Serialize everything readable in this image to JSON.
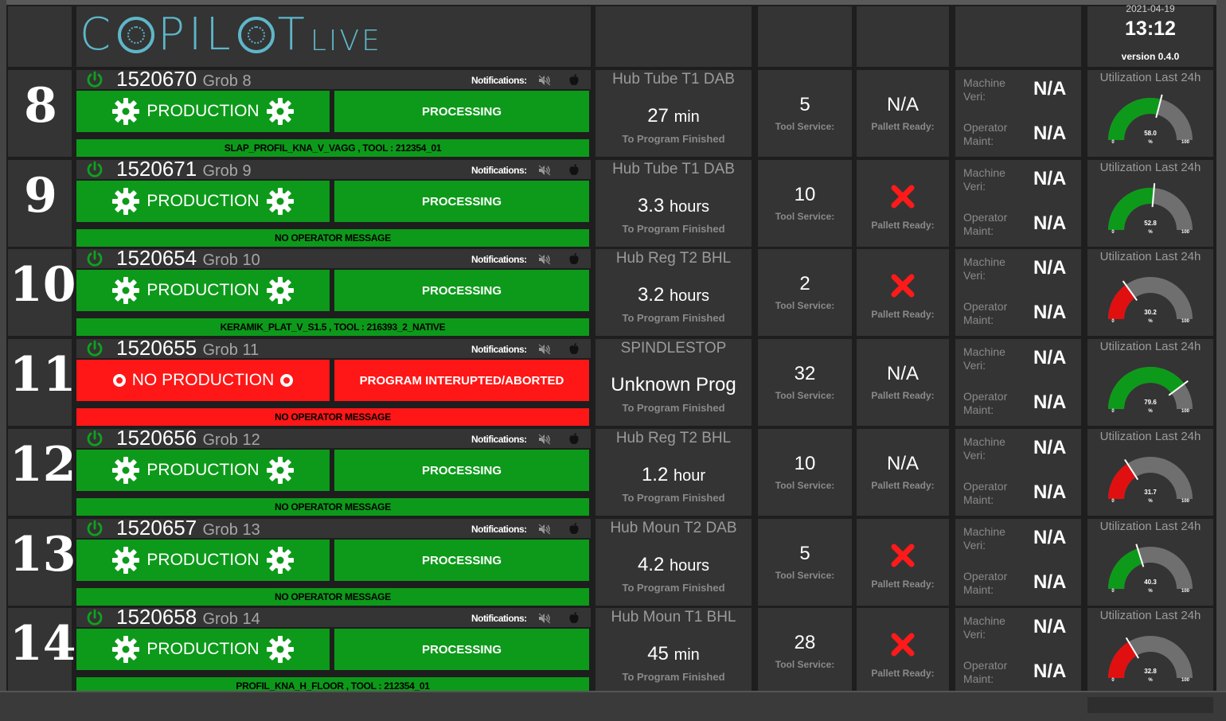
{
  "header": {
    "logo_text": "COPILOT",
    "logo_suffix": "LIVE",
    "date": "2021-04-19",
    "time": "13:12",
    "version": "version 0.4.0"
  },
  "labels": {
    "notifications": "Notifications:",
    "to_program_finished": "To Program Finished",
    "tool_service": "Tool Service:",
    "pallet_ready": "Pallett Ready:",
    "machine_veri": "Machine Veri:",
    "operator_maint": "Operator Maint:",
    "utilization": "Utilization Last 24h",
    "gauge_unit": "%",
    "gauge_min": "0",
    "gauge_max": "100"
  },
  "colors": {
    "production_green": "#0d9a1a",
    "alarm_red": "#ff1616",
    "logo_teal": "#5fb6c9"
  },
  "rows": [
    {
      "number": "8",
      "job_id": "1520670",
      "grob": "Grob 8",
      "state": "PRODUCTION",
      "state_color": "green",
      "status": "PROCESSING",
      "message": "SLAP_PROFIL_KNA_V_VAGG , TOOL : 212354_01",
      "program": "Hub Tube T1 DAB",
      "remaining_value": "27",
      "remaining_unit": "min",
      "tool_service": "5",
      "pallet_ready": "N/A",
      "machine_veri": "N/A",
      "operator_maint": "N/A",
      "utilization": 58.0,
      "utilization_label": "58.0"
    },
    {
      "number": "9",
      "job_id": "1520671",
      "grob": "Grob 9",
      "state": "PRODUCTION",
      "state_color": "green",
      "status": "PROCESSING",
      "message": "NO OPERATOR MESSAGE",
      "program": "Hub Tube T1 DAB",
      "remaining_value": "3.3",
      "remaining_unit": "hours",
      "tool_service": "10",
      "pallet_ready": "x",
      "machine_veri": "N/A",
      "operator_maint": "N/A",
      "utilization": 52.8,
      "utilization_label": "52.8"
    },
    {
      "number": "10",
      "job_id": "1520654",
      "grob": "Grob 10",
      "state": "PRODUCTION",
      "state_color": "green",
      "status": "PROCESSING",
      "message": "KERAMIK_PLAT_V_S1.5 , TOOL : 216393_2_NATIVE",
      "program": "Hub Reg T2 BHL",
      "remaining_value": "3.2",
      "remaining_unit": "hours",
      "tool_service": "2",
      "pallet_ready": "x",
      "machine_veri": "N/A",
      "operator_maint": "N/A",
      "utilization": 30.2,
      "utilization_label": "30.2"
    },
    {
      "number": "11",
      "job_id": "1520655",
      "grob": "Grob 11",
      "state": "NO PRODUCTION",
      "state_color": "red",
      "status": "PROGRAM INTERUPTED/ABORTED",
      "message": "NO OPERATOR MESSAGE",
      "program": "SPINDLESTOP",
      "remaining_value": "Unknown Prog",
      "remaining_unit": "",
      "tool_service": "32",
      "pallet_ready": "N/A",
      "machine_veri": "N/A",
      "operator_maint": "N/A",
      "utilization": 79.6,
      "utilization_label": "79.6"
    },
    {
      "number": "12",
      "job_id": "1520656",
      "grob": "Grob 12",
      "state": "PRODUCTION",
      "state_color": "green",
      "status": "PROCESSING",
      "message": "NO OPERATOR MESSAGE",
      "program": "Hub Reg T2 BHL",
      "remaining_value": "1.2",
      "remaining_unit": "hour",
      "tool_service": "10",
      "pallet_ready": "N/A",
      "machine_veri": "N/A",
      "operator_maint": "N/A",
      "utilization": 31.7,
      "utilization_label": "31.7"
    },
    {
      "number": "13",
      "job_id": "1520657",
      "grob": "Grob 13",
      "state": "PRODUCTION",
      "state_color": "green",
      "status": "PROCESSING",
      "message": "NO OPERATOR MESSAGE",
      "program": "Hub Moun T2 DAB",
      "remaining_value": "4.2",
      "remaining_unit": "hours",
      "tool_service": "5",
      "pallet_ready": "x",
      "machine_veri": "N/A",
      "operator_maint": "N/A",
      "utilization": 40.3,
      "utilization_label": "40.3"
    },
    {
      "number": "14",
      "job_id": "1520658",
      "grob": "Grob 14",
      "state": "PRODUCTION",
      "state_color": "green",
      "status": "PROCESSING",
      "message": "PROFIL_KNA_H_FLOOR , TOOL : 212354_01",
      "program": "Hub Moun T1 BHL",
      "remaining_value": "45",
      "remaining_unit": "min",
      "tool_service": "28",
      "pallet_ready": "x",
      "machine_veri": "N/A",
      "operator_maint": "N/A",
      "utilization": 32.8,
      "utilization_label": "32.8"
    }
  ]
}
